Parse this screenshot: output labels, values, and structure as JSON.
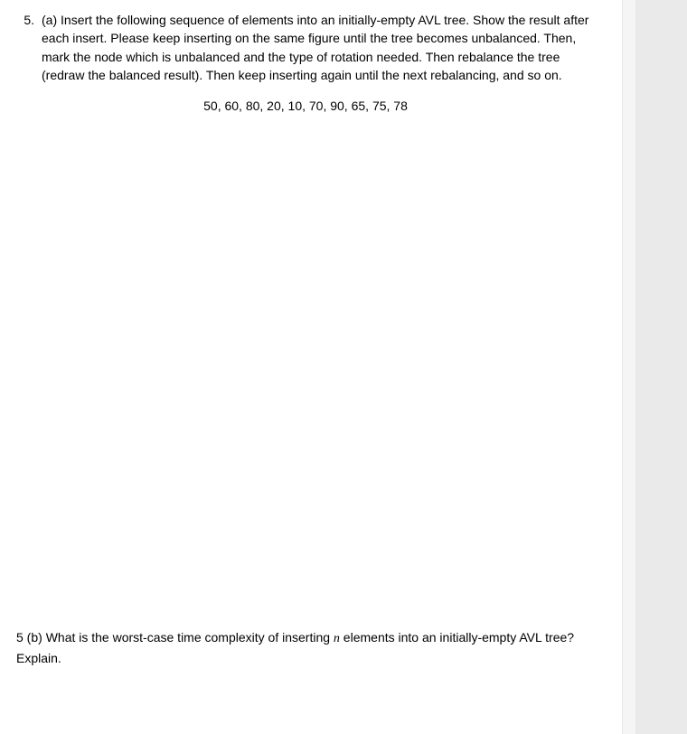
{
  "question": {
    "number": "5.",
    "partA": {
      "label": "(a)",
      "text": "Insert the following sequence of elements into an initially-empty AVL tree. Show the result after each insert. Please keep inserting on the same figure until the tree becomes unbalanced. Then, mark the node which is unbalanced and the type of rotation needed. Then rebalance the tree (redraw the balanced result). Then keep inserting again until the next rebalancing, and so on.",
      "sequence": "50, 60, 80, 20, 10, 70, 90, 65, 75, 78"
    },
    "partB": {
      "label": "5 (b)",
      "text_before_n": "What is the worst-case time complexity of inserting ",
      "variable": "n",
      "text_after_n": " elements into an initially-empty AVL tree? Explain."
    }
  }
}
